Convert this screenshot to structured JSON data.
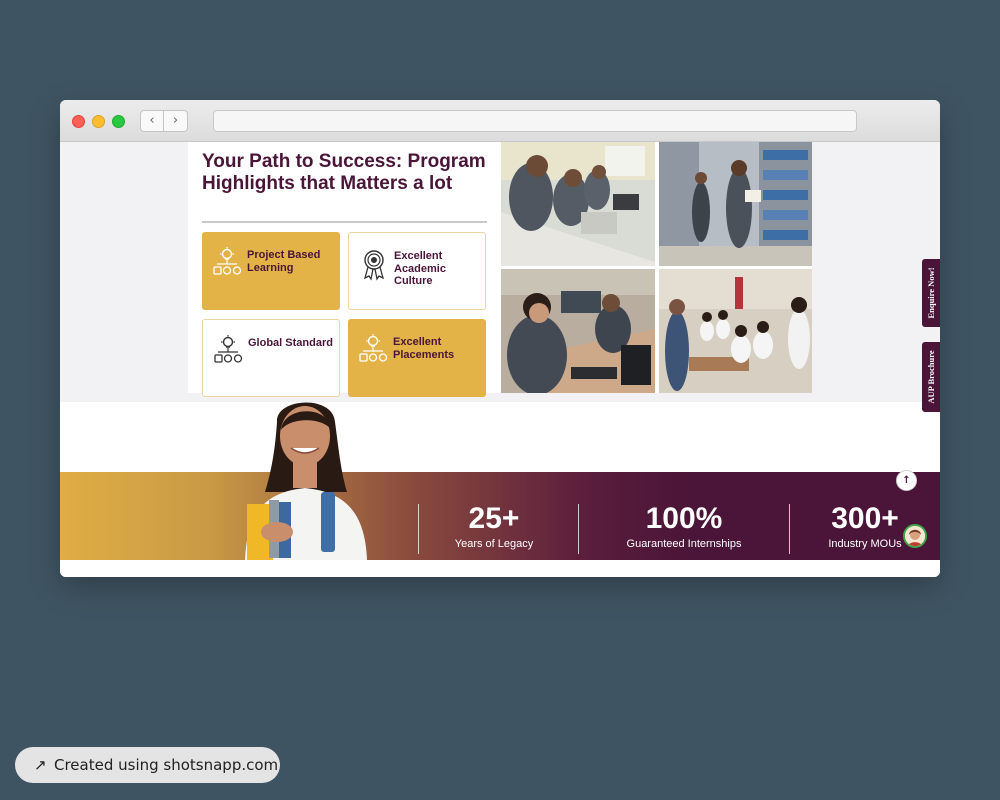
{
  "browser": {
    "back_glyph": "‹",
    "forward_glyph": "›",
    "url": ""
  },
  "highlights": {
    "title": "Your Path to Success: Program Highlights that Matters a lot",
    "cards": [
      {
        "label": "Project Based Learning",
        "icon": "lightbulb-network-icon",
        "style": "gold"
      },
      {
        "label": "Excellent Academic Culture",
        "icon": "award-medal-icon",
        "style": "white"
      },
      {
        "label": "Global Standard",
        "icon": "lightbulb-network-icon",
        "style": "white"
      },
      {
        "label": "Excellent Placements",
        "icon": "lightbulb-network-icon",
        "style": "gold"
      }
    ],
    "photos": [
      {
        "subject": "lab-students-photo"
      },
      {
        "subject": "library-students-photo"
      },
      {
        "subject": "computer-lab-photo"
      },
      {
        "subject": "classroom-photo"
      }
    ]
  },
  "side_tabs": {
    "enquire": "Enquire Now!",
    "brochure": "AUP Brochure"
  },
  "stats": [
    {
      "value": "25+",
      "caption": "Years of Legacy"
    },
    {
      "value": "100%",
      "caption": "Guaranteed Internships"
    },
    {
      "value": "300+",
      "caption": "Industry MOUs"
    }
  ],
  "scroll_top_glyph": "↑",
  "badge": {
    "arrow": "↗",
    "text": "Created using shotsnapp.com"
  },
  "colors": {
    "brand_plum": "#4a1538",
    "brand_gold": "#e3b347",
    "desktop_bg": "#3f5462"
  }
}
